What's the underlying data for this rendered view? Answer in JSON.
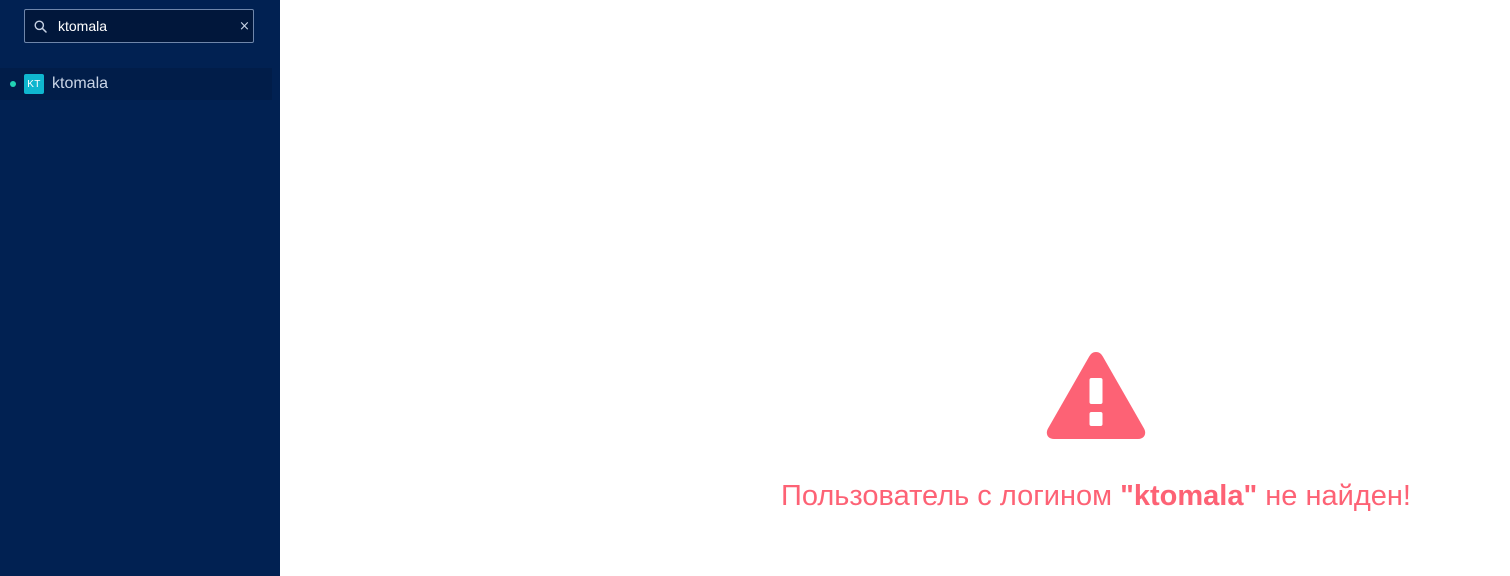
{
  "sidebar": {
    "search": {
      "value": "ktomala",
      "clear_label": "×",
      "search_icon": "search-icon",
      "clear_icon": "close-icon"
    },
    "users": [
      {
        "initials": "KT",
        "name": "ktomala",
        "status": "online"
      }
    ]
  },
  "main": {
    "error": {
      "icon": "warning-triangle-icon",
      "prefix": "Пользователь с логином ",
      "login": "\"ktomala\"",
      "suffix": " не найден!"
    }
  },
  "colors": {
    "sidebar_bg": "#012152",
    "search_bg": "#01173b",
    "accent_teal": "#0fb6cf",
    "status_online": "#21d3b4",
    "error": "#fd6275"
  }
}
